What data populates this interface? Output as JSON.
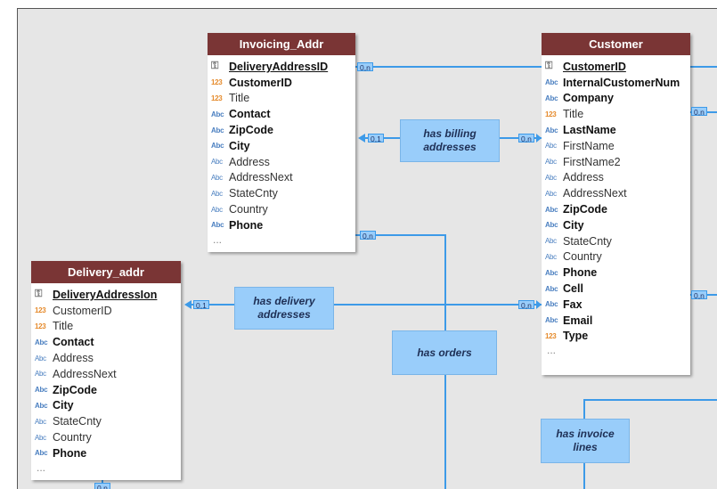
{
  "entities": {
    "invoicing_addr": {
      "title": "Invoicing_Addr",
      "fields": [
        {
          "type": "key",
          "icon": "⚿",
          "name": "DeliveryAddressID",
          "key": true,
          "bold": true
        },
        {
          "type": "num",
          "icon": "123",
          "name": "CustomerID",
          "bold": true
        },
        {
          "type": "num",
          "icon": "123",
          "name": "Title",
          "bold": false
        },
        {
          "type": "text",
          "icon": "Abc",
          "name": "Contact",
          "bold": true
        },
        {
          "type": "text",
          "icon": "Abc",
          "name": "ZipCode",
          "bold": true
        },
        {
          "type": "text",
          "icon": "Abc",
          "name": "City",
          "bold": true
        },
        {
          "type": "text",
          "icon": "Abc",
          "name": "Address",
          "bold": false
        },
        {
          "type": "text",
          "icon": "Abc",
          "name": "AddressNext",
          "bold": false
        },
        {
          "type": "text",
          "icon": "Abc",
          "name": "StateCnty",
          "bold": false
        },
        {
          "type": "text",
          "icon": "Abc",
          "name": "Country",
          "bold": false
        },
        {
          "type": "text",
          "icon": "Abc",
          "name": "Phone",
          "bold": true
        }
      ],
      "more": "..."
    },
    "customer": {
      "title": "Customer",
      "fields": [
        {
          "type": "key",
          "icon": "⚿",
          "name": "CustomerID",
          "key": true,
          "bold": true
        },
        {
          "type": "text",
          "icon": "Abc",
          "name": "InternalCustomerNum",
          "bold": true
        },
        {
          "type": "text",
          "icon": "Abc",
          "name": "Company",
          "bold": true
        },
        {
          "type": "num",
          "icon": "123",
          "name": "Title",
          "bold": false
        },
        {
          "type": "text",
          "icon": "Abc",
          "name": "LastName",
          "bold": true
        },
        {
          "type": "text",
          "icon": "Abc",
          "name": "FirstName",
          "bold": false
        },
        {
          "type": "text",
          "icon": "Abc",
          "name": "FirstName2",
          "bold": false
        },
        {
          "type": "text",
          "icon": "Abc",
          "name": "Address",
          "bold": false
        },
        {
          "type": "text",
          "icon": "Abc",
          "name": "AddressNext",
          "bold": false
        },
        {
          "type": "text",
          "icon": "Abc",
          "name": "ZipCode",
          "bold": true
        },
        {
          "type": "text",
          "icon": "Abc",
          "name": "City",
          "bold": true
        },
        {
          "type": "text",
          "icon": "Abc",
          "name": "StateCnty",
          "bold": false
        },
        {
          "type": "text",
          "icon": "Abc",
          "name": "Country",
          "bold": false
        },
        {
          "type": "text",
          "icon": "Abc",
          "name": "Phone",
          "bold": true
        },
        {
          "type": "text",
          "icon": "Abc",
          "name": "Cell",
          "bold": true
        },
        {
          "type": "text",
          "icon": "Abc",
          "name": "Fax",
          "bold": true
        },
        {
          "type": "text",
          "icon": "Abc",
          "name": "Email",
          "bold": true
        },
        {
          "type": "num",
          "icon": "123",
          "name": "Type",
          "bold": true
        }
      ],
      "more": "..."
    },
    "delivery_addr": {
      "title": "Delivery_addr",
      "fields": [
        {
          "type": "key",
          "icon": "⚿",
          "name": "DeliveryAddressIon",
          "key": true,
          "bold": true
        },
        {
          "type": "num",
          "icon": "123",
          "name": "CustomerID",
          "bold": false
        },
        {
          "type": "num",
          "icon": "123",
          "name": "Title",
          "bold": false
        },
        {
          "type": "text",
          "icon": "Abc",
          "name": "Contact",
          "bold": true
        },
        {
          "type": "text",
          "icon": "Abc",
          "name": "Address",
          "bold": false
        },
        {
          "type": "text",
          "icon": "Abc",
          "name": "AddressNext",
          "bold": false
        },
        {
          "type": "text",
          "icon": "Abc",
          "name": "ZipCode",
          "bold": true
        },
        {
          "type": "text",
          "icon": "Abc",
          "name": "City",
          "bold": true
        },
        {
          "type": "text",
          "icon": "Abc",
          "name": "StateCnty",
          "bold": false
        },
        {
          "type": "text",
          "icon": "Abc",
          "name": "Country",
          "bold": false
        },
        {
          "type": "text",
          "icon": "Abc",
          "name": "Phone",
          "bold": true
        }
      ],
      "more": "..."
    }
  },
  "relationships": {
    "has_billing": "has billing addresses",
    "has_delivery": "has delivery addresses",
    "has_orders": "has orders",
    "has_invoice_lines": "has invoice lines"
  },
  "cardinalities": {
    "zero_n": "0,n",
    "zero_one": "0,1"
  },
  "colors": {
    "entity_header": "#7a3535",
    "relationship_fill": "#99cdfa",
    "connector": "#3d9ae8",
    "canvas": "#e6e6e6"
  }
}
